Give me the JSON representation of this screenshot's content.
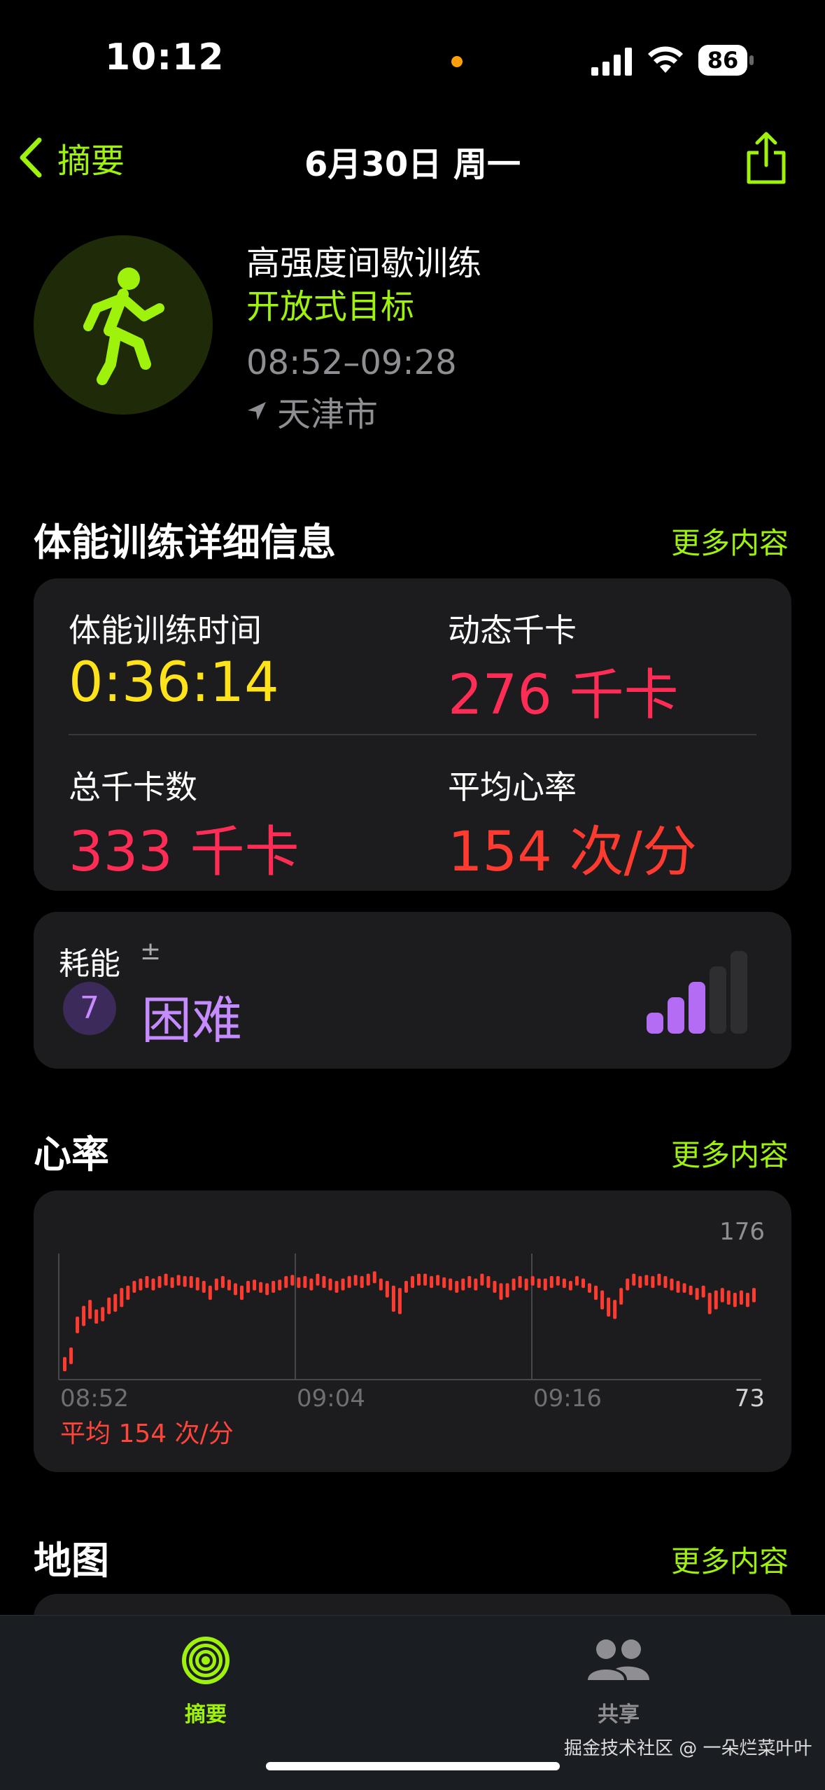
{
  "status_bar": {
    "time": "10:12",
    "battery": "86"
  },
  "nav": {
    "back_label": "摘要",
    "title": "6月30日 周一"
  },
  "workout": {
    "name": "高强度间歇训练",
    "goal": "开放式目标",
    "time_range": "08:52–09:28",
    "location": "天津市"
  },
  "details": {
    "section_title": "体能训练详细信息",
    "more_label": "更多内容",
    "metrics": [
      {
        "label": "体能训练时间",
        "value": "0:36:14",
        "color": "#ffe31a"
      },
      {
        "label": "动态千卡",
        "value": "276 千卡",
        "color": "#ff2d55"
      },
      {
        "label": "总千卡数",
        "value": "333 千卡",
        "color": "#ff2d55"
      },
      {
        "label": "平均心率",
        "value": "154 次/分",
        "color": "#ff3b30"
      }
    ]
  },
  "effort": {
    "label": "耗能",
    "pm": "±",
    "level": "7",
    "value": "困难",
    "bars_total": 5,
    "bars_filled": 3
  },
  "heart_rate": {
    "section_title": "心率",
    "more_label": "更多内容",
    "average_label": "平均 154 次/分"
  },
  "map": {
    "section_title": "地图",
    "more_label": "更多内容"
  },
  "tabs": [
    {
      "label": "摘要",
      "active": true
    },
    {
      "label": "共享",
      "active": false
    }
  ],
  "watermark": "掘金技术社区 @ 一朵烂菜叶叶",
  "chart_data": {
    "type": "bar",
    "title": "",
    "x_ticks": [
      "08:52",
      "09:04",
      "09:16"
    ],
    "ylim": [
      73,
      176
    ],
    "y_max_label": "176",
    "y_min_label": "73",
    "start_minutes": 0,
    "series": [
      {
        "values": [
          [
            80,
            92
          ],
          [
            86,
            100
          ],
          [
            112,
            126
          ],
          [
            118,
            135
          ],
          [
            124,
            140
          ],
          [
            120,
            132
          ],
          [
            122,
            134
          ],
          [
            128,
            142
          ],
          [
            130,
            145
          ],
          [
            134,
            150
          ],
          [
            140,
            152
          ],
          [
            146,
            156
          ],
          [
            148,
            158
          ],
          [
            150,
            160
          ],
          [
            148,
            158
          ],
          [
            150,
            160
          ],
          [
            152,
            162
          ],
          [
            150,
            159
          ],
          [
            152,
            161
          ],
          [
            151,
            160
          ],
          [
            150,
            160
          ],
          [
            148,
            159
          ],
          [
            146,
            156
          ],
          [
            140,
            152
          ],
          [
            148,
            158
          ],
          [
            150,
            160
          ],
          [
            148,
            157
          ],
          [
            144,
            154
          ],
          [
            140,
            152
          ],
          [
            146,
            156
          ],
          [
            148,
            157
          ],
          [
            146,
            155
          ],
          [
            144,
            154
          ],
          [
            146,
            156
          ],
          [
            148,
            157
          ],
          [
            150,
            160
          ],
          [
            152,
            161
          ],
          [
            150,
            159
          ],
          [
            150,
            160
          ],
          [
            148,
            158
          ],
          [
            152,
            162
          ],
          [
            150,
            160
          ],
          [
            148,
            158
          ],
          [
            146,
            156
          ],
          [
            148,
            158
          ],
          [
            150,
            160
          ],
          [
            152,
            161
          ],
          [
            150,
            160
          ],
          [
            152,
            162
          ],
          [
            154,
            164
          ],
          [
            148,
            158
          ],
          [
            142,
            156
          ],
          [
            130,
            152
          ],
          [
            128,
            150
          ],
          [
            146,
            156
          ],
          [
            150,
            160
          ],
          [
            152,
            162
          ],
          [
            152,
            162
          ],
          [
            150,
            160
          ],
          [
            152,
            161
          ],
          [
            150,
            159
          ],
          [
            148,
            158
          ],
          [
            146,
            156
          ],
          [
            148,
            158
          ],
          [
            150,
            160
          ],
          [
            148,
            158
          ],
          [
            152,
            162
          ],
          [
            150,
            160
          ],
          [
            146,
            156
          ],
          [
            140,
            154
          ],
          [
            142,
            154
          ],
          [
            148,
            158
          ],
          [
            150,
            160
          ],
          [
            148,
            158
          ],
          [
            152,
            160
          ],
          [
            150,
            158
          ],
          [
            148,
            158
          ],
          [
            150,
            160
          ],
          [
            152,
            160
          ],
          [
            150,
            158
          ],
          [
            148,
            156
          ],
          [
            152,
            160
          ],
          [
            150,
            158
          ],
          [
            146,
            154
          ],
          [
            140,
            152
          ],
          [
            132,
            148
          ],
          [
            126,
            142
          ],
          [
            124,
            140
          ],
          [
            136,
            150
          ],
          [
            148,
            158
          ],
          [
            152,
            162
          ],
          [
            150,
            160
          ],
          [
            152,
            161
          ],
          [
            150,
            160
          ],
          [
            152,
            162
          ],
          [
            150,
            160
          ],
          [
            148,
            158
          ],
          [
            146,
            156
          ],
          [
            146,
            154
          ],
          [
            144,
            152
          ],
          [
            140,
            150
          ],
          [
            142,
            152
          ],
          [
            128,
            146
          ],
          [
            132,
            148
          ],
          [
            138,
            150
          ],
          [
            136,
            148
          ],
          [
            134,
            146
          ],
          [
            136,
            148
          ],
          [
            134,
            146
          ],
          [
            138,
            150
          ]
        ]
      }
    ]
  }
}
